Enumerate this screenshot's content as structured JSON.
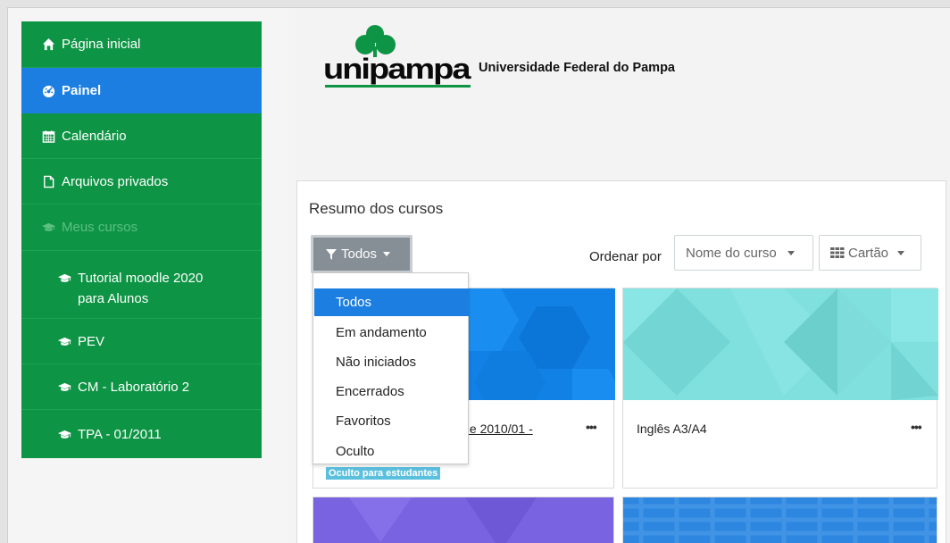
{
  "sidebar": {
    "items": [
      {
        "label": "Página inicial",
        "icon": "home-icon"
      },
      {
        "label": "Painel",
        "icon": "dashboard-icon",
        "active": true
      },
      {
        "label": "Calendário",
        "icon": "calendar-icon"
      },
      {
        "label": "Arquivos privados",
        "icon": "file-icon"
      },
      {
        "label": "Meus cursos",
        "icon": "graduation-cap-icon"
      }
    ],
    "courses": [
      {
        "label_line1": "Tutorial moodle 2020",
        "label_line2": "para Alunos"
      },
      {
        "label_line1": "PEV"
      },
      {
        "label_line1": "CM - Laboratório 2"
      },
      {
        "label_line1": "TPA - 01/2011"
      }
    ]
  },
  "header": {
    "logo_word": "unipampa",
    "university_name": "Universidade Federal do Pampa"
  },
  "overview": {
    "title": "Resumo dos cursos",
    "filter_label": "Todos",
    "order_label": "Ordenar por",
    "sort_value": "Nome do curso",
    "view_value": "Cartão",
    "filter_options": [
      "Todos",
      "Em andamento",
      "Não iniciados",
      "Encerrados",
      "Favoritos",
      "Oculto"
    ],
    "filter_selected": "Todos"
  },
  "cards": [
    {
      "title": "dle 2010/01 -",
      "badge": "Oculto para estudantes",
      "menu": "•••"
    },
    {
      "title": "Inglês A3/A4",
      "menu": "•••"
    }
  ],
  "colors": {
    "sidebar_green": "#0d9444",
    "active_blue": "#1b7ee0",
    "button_gray": "#868e96"
  }
}
